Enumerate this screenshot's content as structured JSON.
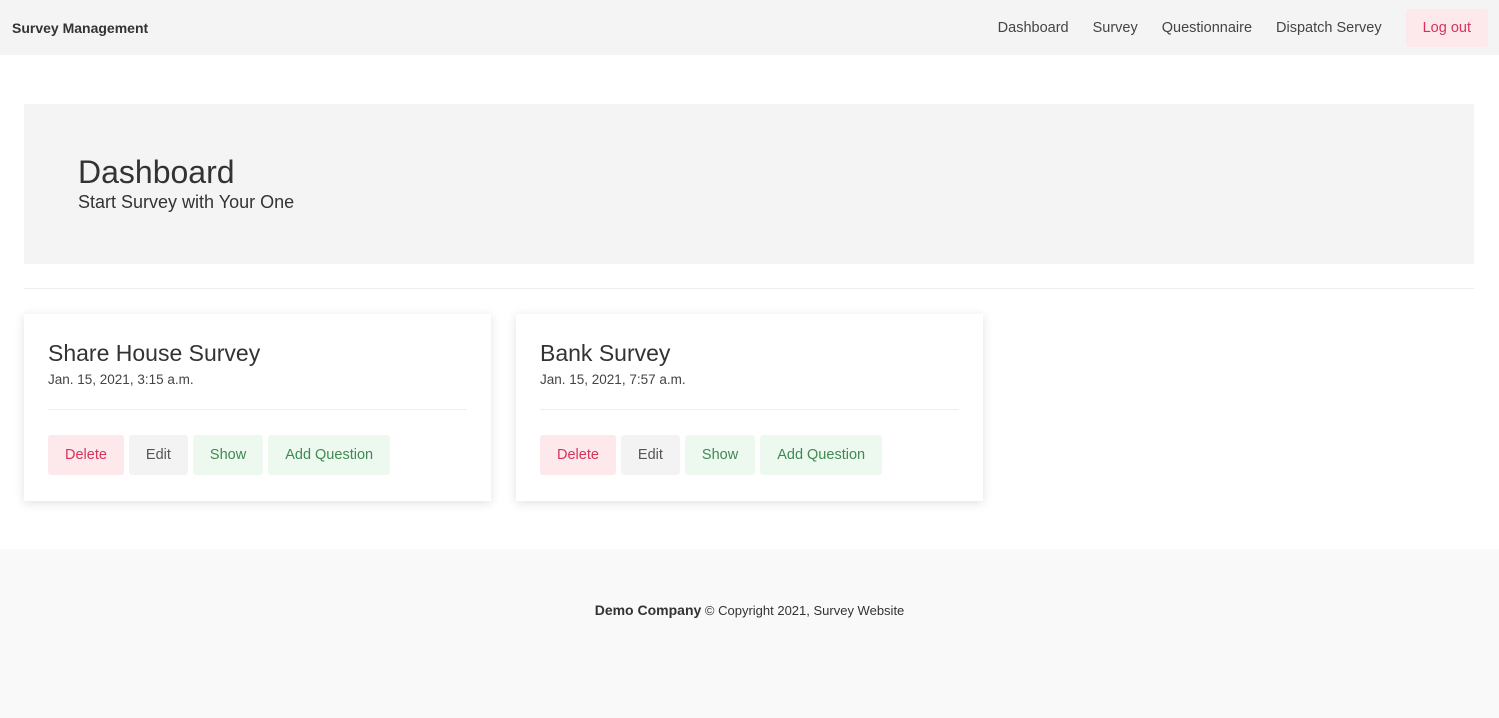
{
  "nav": {
    "brand": "Survey Management",
    "links": [
      "Dashboard",
      "Survey",
      "Questionnaire",
      "Dispatch Servey"
    ],
    "logout": "Log out"
  },
  "hero": {
    "title": "Dashboard",
    "subtitle": "Start Survey with Your One"
  },
  "cards": [
    {
      "title": "Share House Survey",
      "date": "Jan. 15, 2021, 3:15 a.m.",
      "buttons": [
        "Delete",
        "Edit",
        "Show",
        "Add Question"
      ]
    },
    {
      "title": "Bank Survey",
      "date": "Jan. 15, 2021, 7:57 a.m.",
      "buttons": [
        "Delete",
        "Edit",
        "Show",
        "Add Question"
      ]
    }
  ],
  "footer": {
    "company": "Demo Company",
    "copyright": "© Copyright 2021, Survey Website"
  },
  "colors": {
    "danger": "#d6335a",
    "success": "#3f8a52"
  }
}
